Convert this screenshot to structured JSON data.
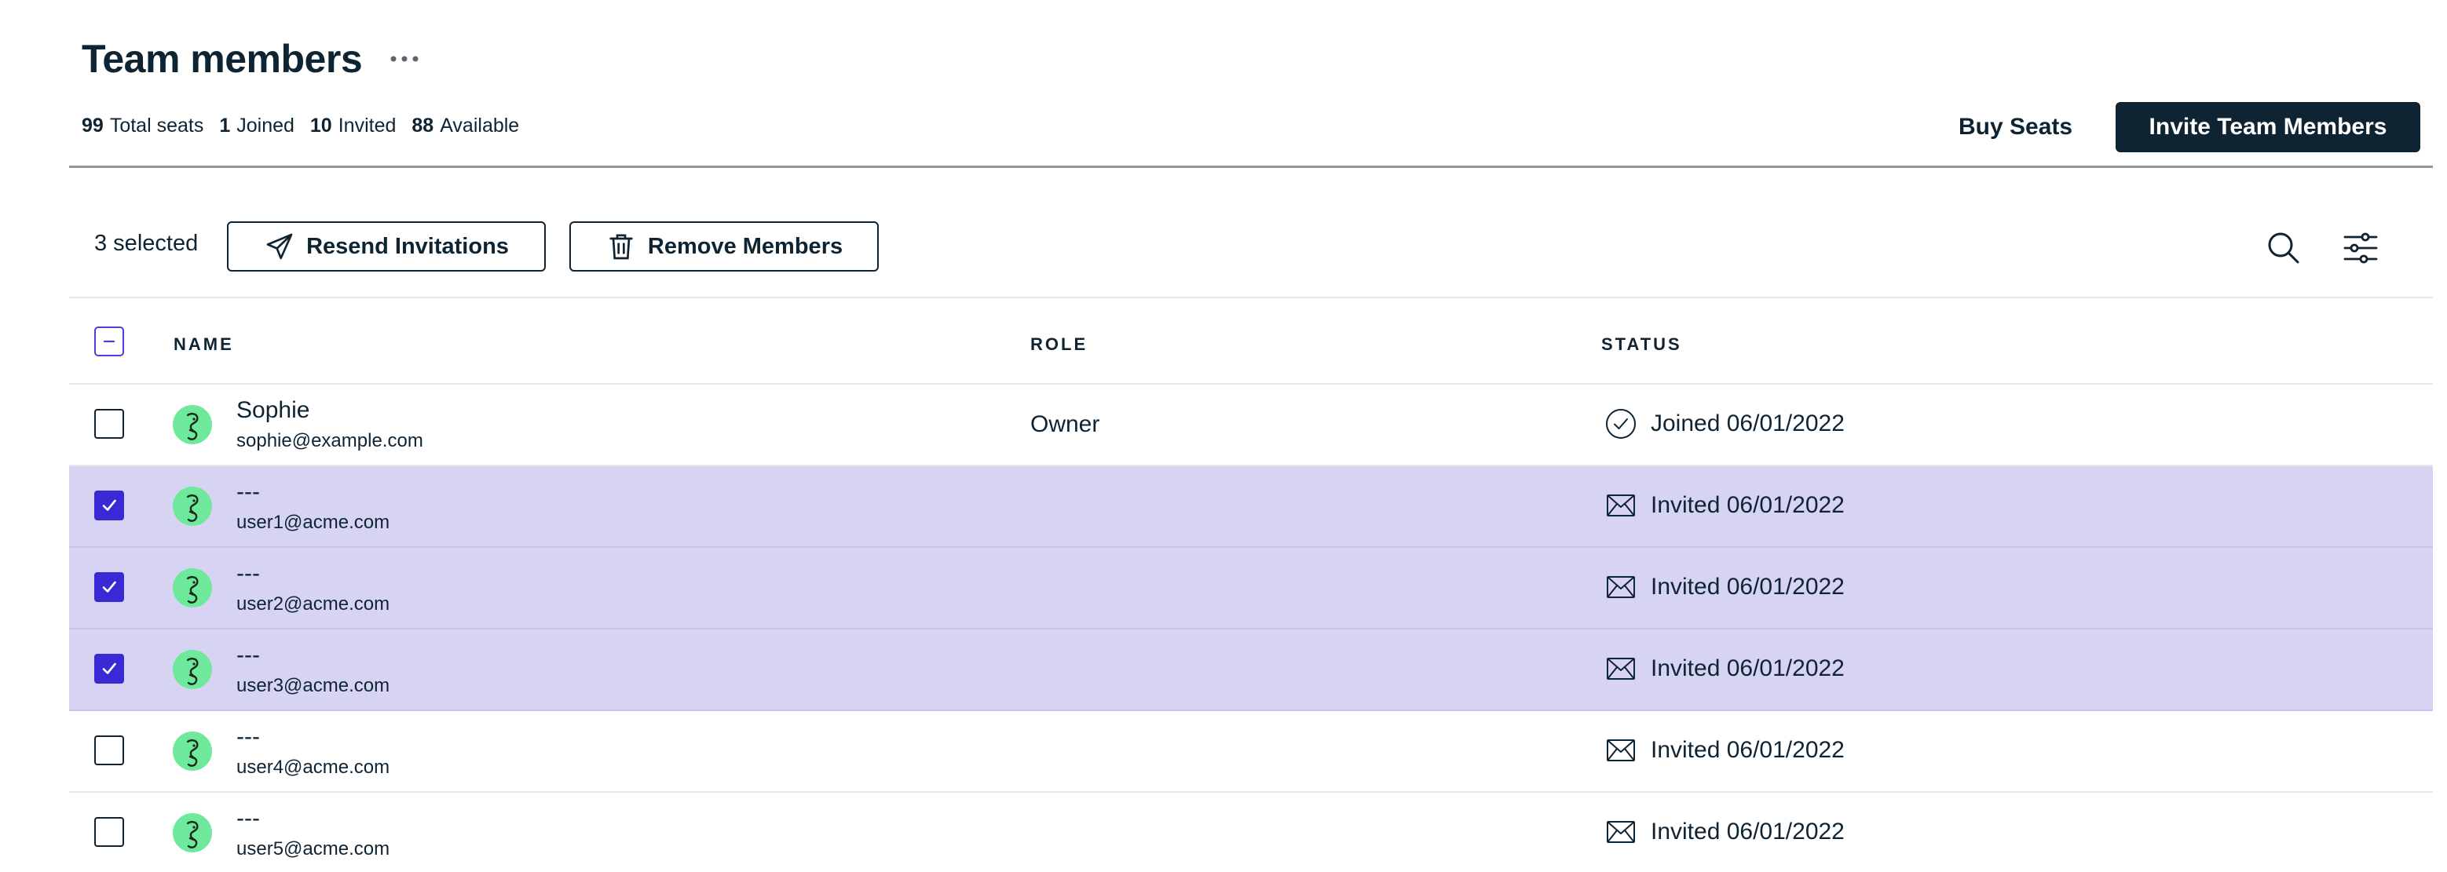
{
  "page": {
    "title": "Team members",
    "more_label": "More options"
  },
  "seats": [
    {
      "value": "99",
      "label": "Total seats"
    },
    {
      "value": "1",
      "label": "Joined"
    },
    {
      "value": "10",
      "label": "Invited"
    },
    {
      "value": "88",
      "label": "Available"
    }
  ],
  "actions": {
    "buy_seats": "Buy Seats",
    "invite": "Invite Team Members"
  },
  "toolbar": {
    "selected_count": "3 selected",
    "resend": "Resend Invitations",
    "remove": "Remove Members"
  },
  "table": {
    "columns": {
      "name": "NAME",
      "role": "ROLE",
      "status": "STATUS"
    },
    "rows": [
      {
        "name": "Sophie",
        "email": "sophie@example.com",
        "role": "Owner",
        "status": "Joined 06/01/2022",
        "status_icon": "check-circle-icon",
        "selected": false
      },
      {
        "name": "---",
        "email": "user1@acme.com",
        "role": "",
        "status": "Invited 06/01/2022",
        "status_icon": "envelope-icon",
        "selected": true
      },
      {
        "name": "---",
        "email": "user2@acme.com",
        "role": "",
        "status": "Invited 06/01/2022",
        "status_icon": "envelope-icon",
        "selected": true
      },
      {
        "name": "---",
        "email": "user3@acme.com",
        "role": "",
        "status": "Invited 06/01/2022",
        "status_icon": "envelope-icon",
        "selected": true
      },
      {
        "name": "---",
        "email": "user4@acme.com",
        "role": "",
        "status": "Invited 06/01/2022",
        "status_icon": "envelope-icon",
        "selected": false
      },
      {
        "name": "---",
        "email": "user5@acme.com",
        "role": "",
        "status": "Invited 06/01/2022",
        "status_icon": "envelope-icon",
        "selected": false
      }
    ]
  },
  "colors": {
    "primary": "#0f2433",
    "selected_row": "#d7d4f3",
    "checkbox_checked": "#3b29d6",
    "avatar": "#6ee89a"
  }
}
